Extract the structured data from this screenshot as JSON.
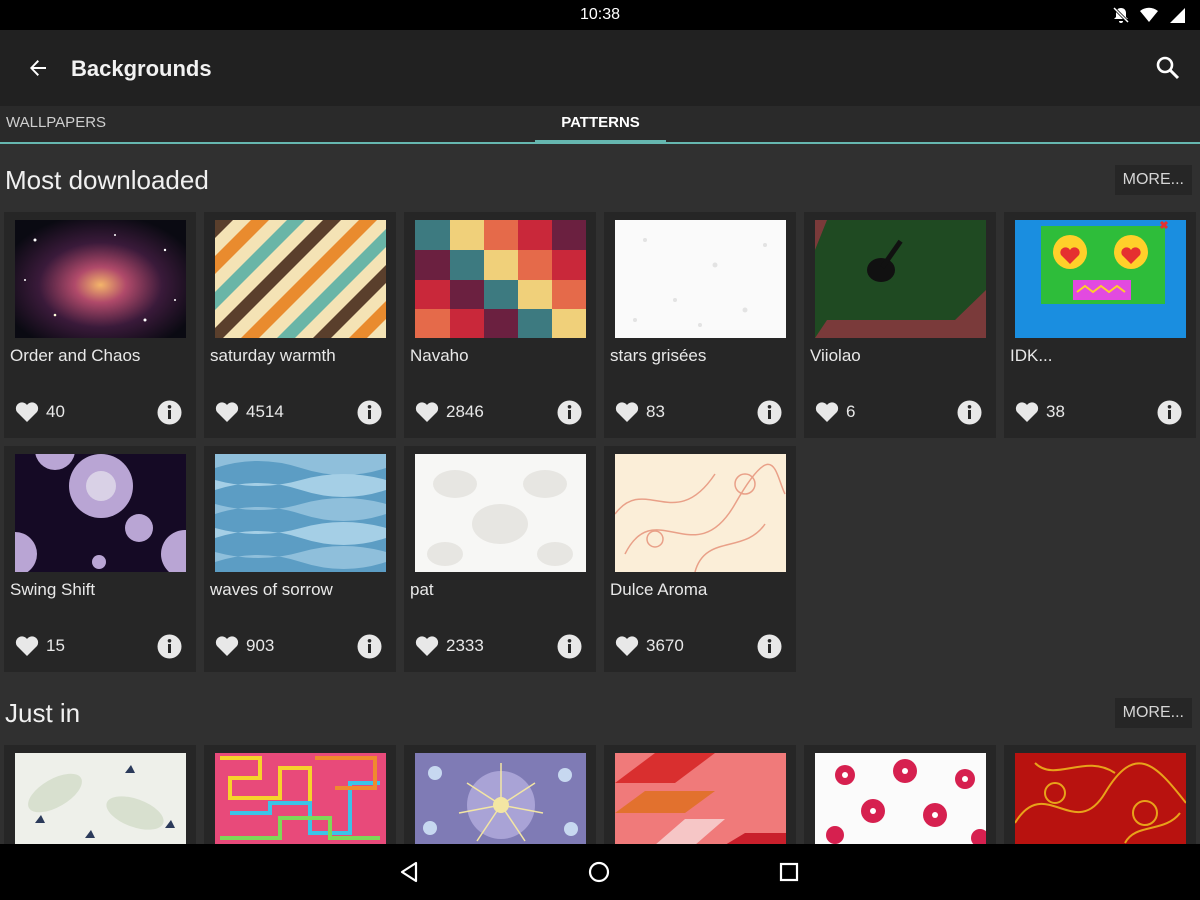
{
  "status_bar": {
    "time": "10:38",
    "icons": [
      "notifications-off-icon",
      "wifi-icon",
      "battery-icon"
    ]
  },
  "app_bar": {
    "title": "Backgrounds",
    "back_icon": "arrow-back-icon",
    "search_icon": "search-icon"
  },
  "tabs": [
    {
      "label": "WALLPAPERS",
      "selected": false
    },
    {
      "label": "PATTERNS",
      "selected": true
    }
  ],
  "sections": [
    {
      "title": "Most downloaded",
      "more_label": "MORE...",
      "items": [
        {
          "name": "Order and Chaos",
          "likes": "40"
        },
        {
          "name": "saturday warmth",
          "likes": "4514"
        },
        {
          "name": "Navaho",
          "likes": "2846"
        },
        {
          "name": "stars grisées",
          "likes": "83"
        },
        {
          "name": "Viiolao",
          "likes": "6"
        },
        {
          "name": "IDK...",
          "likes": "38"
        },
        {
          "name": "Swing Shift",
          "likes": "15"
        },
        {
          "name": "waves of sorrow",
          "likes": "903"
        },
        {
          "name": "pat",
          "likes": "2333"
        },
        {
          "name": "Dulce Aroma",
          "likes": "3670"
        }
      ]
    },
    {
      "title": "Just in",
      "more_label": "MORE..."
    }
  ],
  "nav_bar": {
    "icons": [
      "back-triangle-icon",
      "home-circle-icon",
      "recents-square-icon"
    ]
  },
  "colors": {
    "accent": "#66b7b0",
    "background": "#303030",
    "card": "#262626",
    "appbar": "#212121"
  }
}
